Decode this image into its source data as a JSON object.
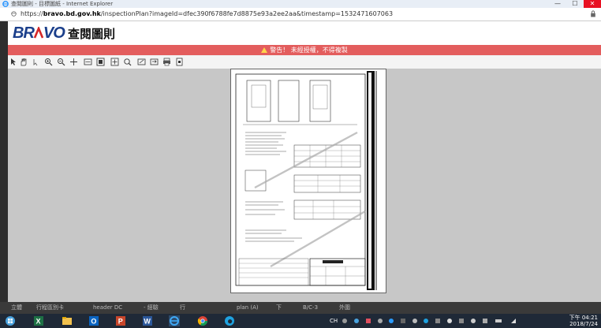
{
  "window": {
    "title": "查閱圖則 - 目標圖紙 - Internet Explorer",
    "minimize_glyph": "—",
    "maximize_glyph": "☐",
    "close_glyph": "✕"
  },
  "address": {
    "protocol": "https://",
    "host": "bravo.bd.gov.hk",
    "path": "/inspectionPlan?imageId=dfec390f6788fe7d8875e93a2ee2aa&timestamp=1532471607063"
  },
  "brand": {
    "logo_text_pre": "BR",
    "logo_text_post": "VO",
    "title": "查閱圖則"
  },
  "warning": {
    "text": "警告！ 未經授權，不得複製"
  },
  "toolbar": {
    "tools": [
      "pointer-icon",
      "hand-icon",
      "select-icon",
      "zoom-in-icon",
      "zoom-out-icon",
      "pan-icon",
      "fit-width-icon",
      "fit-page-icon",
      "magnify-icon",
      "zoom-area-icon",
      "rotate-icon",
      "rotate-right-icon",
      "print-icon",
      "page-icon"
    ]
  },
  "status_strip": {
    "items": [
      "立體",
      "行程區別卡",
      "header DC",
      "- 經驗",
      "行",
      "plan (A)",
      "下",
      "B/C-3",
      "外圍"
    ]
  },
  "tray": {
    "lang": "CH",
    "time": "下午 04:21",
    "date": "2018/7/24"
  },
  "colors": {
    "warning_bg": "#e35d5d",
    "brand_blue": "#1b3f8b",
    "canvas_bg": "#c7c7c7"
  }
}
